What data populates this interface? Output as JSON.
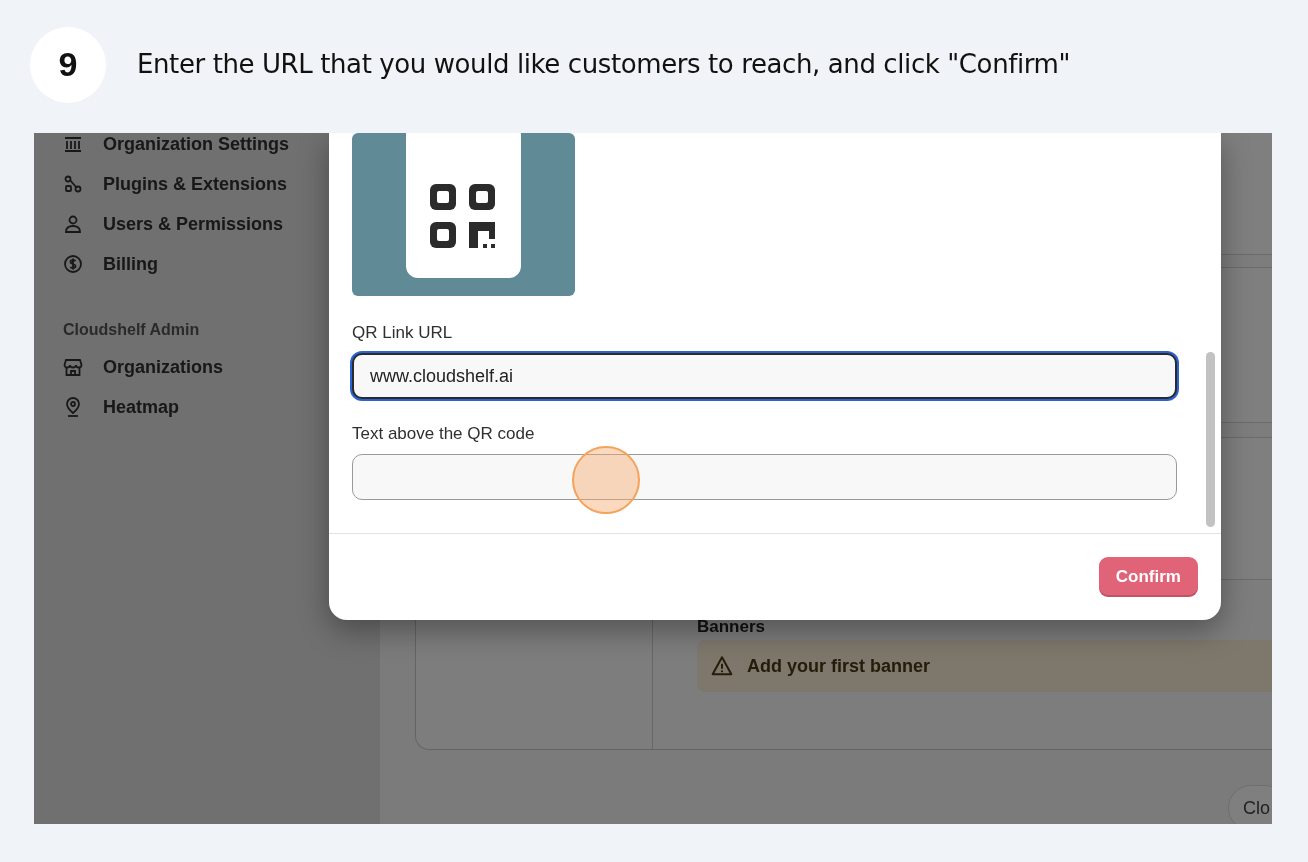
{
  "step": {
    "number": "9",
    "instruction": "Enter the URL that you would like customers to reach, and click \"Confirm\""
  },
  "sidebar": {
    "items": [
      {
        "label": "Organization Settings"
      },
      {
        "label": "Plugins & Extensions"
      },
      {
        "label": "Users & Permissions"
      },
      {
        "label": "Billing"
      }
    ],
    "section": "Cloudshelf Admin",
    "admin_items": [
      {
        "label": "Organizations"
      },
      {
        "label": "Heatmap"
      }
    ]
  },
  "main": {
    "section_heading": "Banners",
    "banner": "Add your first banner",
    "corner_button": "Clo"
  },
  "modal": {
    "fields": [
      {
        "label": "QR Link URL",
        "value": "www.cloudshelf.ai",
        "focused": true
      },
      {
        "label": "Text above the QR code",
        "focused": false
      }
    ],
    "confirm": "Confirm"
  }
}
